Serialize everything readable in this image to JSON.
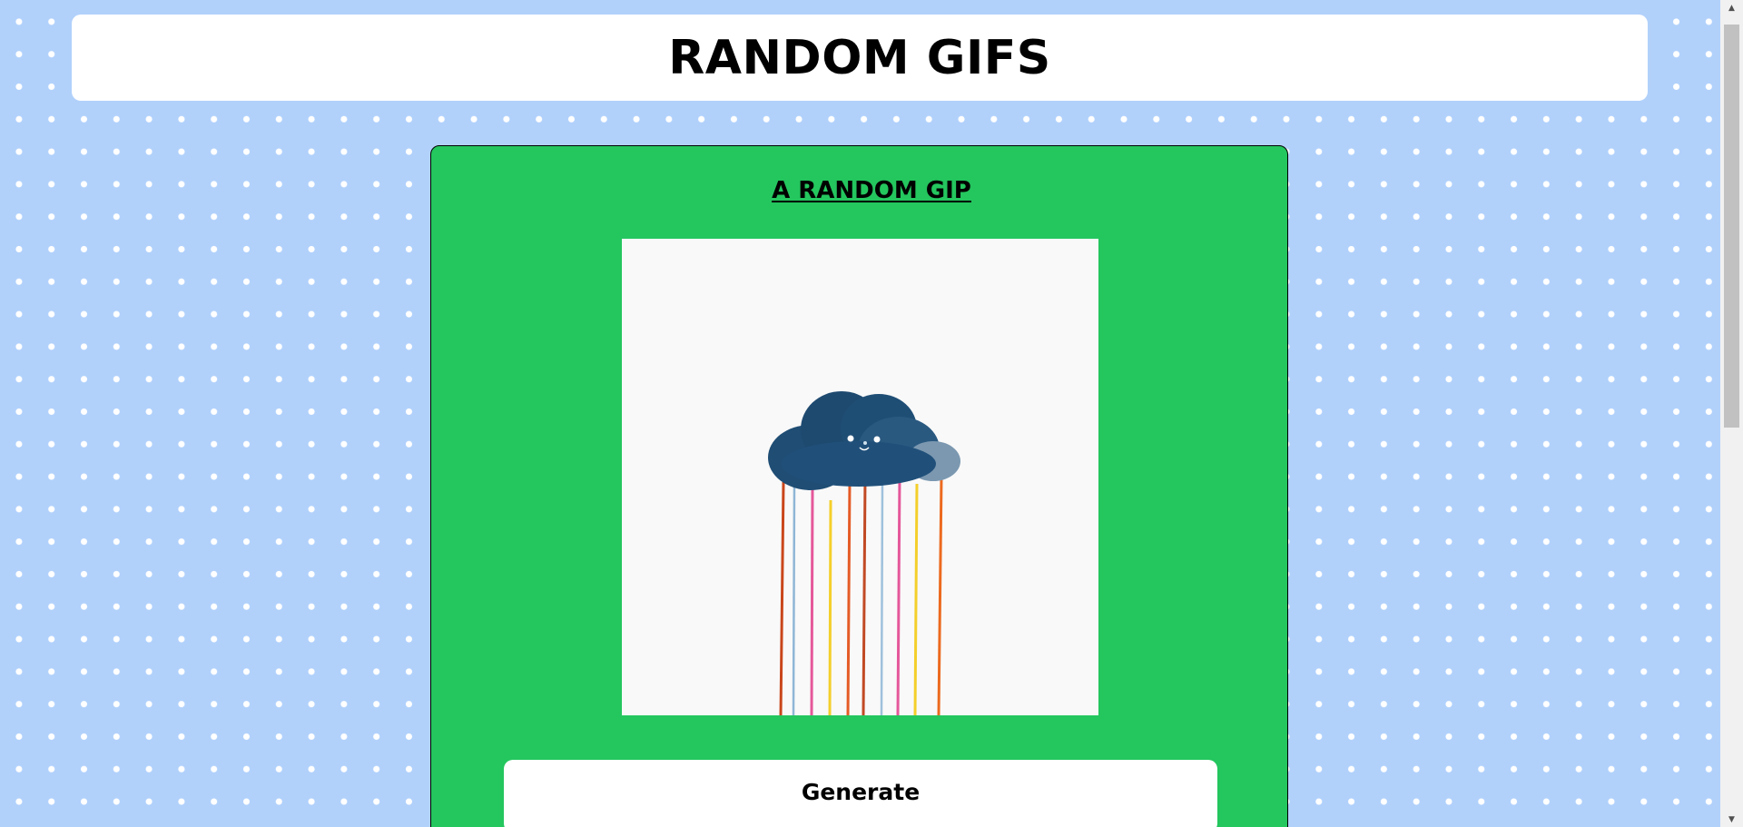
{
  "header": {
    "title": "RANDOM GIFS"
  },
  "card": {
    "title": "A RANDOM GIP",
    "gif_alt": "cloud-rain-gif",
    "generate_label": "Generate"
  },
  "colors": {
    "page_background": "#b1d1fb",
    "card_background": "#24c65e",
    "header_background": "#ffffff",
    "button_background": "#ffffff"
  },
  "scrollbar": {
    "up_arrow": "▲",
    "down_arrow": "▼"
  }
}
